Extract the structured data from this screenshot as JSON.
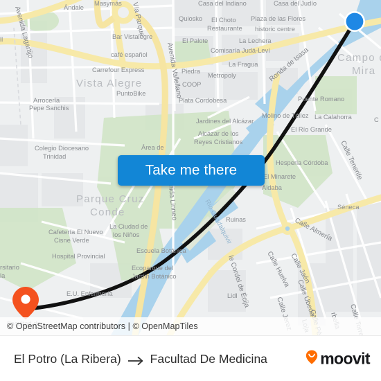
{
  "app": {
    "brand_name": "moovit",
    "brand_icon": "moovit-pin-smile-icon"
  },
  "map": {
    "attribution": "© OpenStreetMap contributors | © OpenMapTiles",
    "origin_marker": {
      "icon": "blue-circle-marker",
      "color": "#1e88e5",
      "label": "El Potro (La Ribera)"
    },
    "destination_marker": {
      "icon": "orange-pin-marker",
      "color": "#f4511e",
      "label": "Facultad De Medicina"
    },
    "route": {
      "color": "#111111",
      "style": "solid-thick-line"
    },
    "labels": [
      "Ándale",
      "Masymás",
      "Casa del Indiano",
      "Casa del Judío",
      "Avenida Lagartijo",
      "Vía Parque",
      "Quiosko",
      "El Choto Restaurante",
      "Plaza de las Flores",
      "historic centre",
      "El Palote",
      "La Lechera",
      "Bar Vistalegre",
      "café español",
      "Comisaría Judá-Levi",
      "La Fragua",
      "Carrefour Express",
      "Piedra",
      "Metropoly",
      "Vista Alegre",
      "Avenida Vallellano",
      "COOP",
      "PuntoBike",
      "Plata Cordobesa",
      "Ronda de Isasa",
      "Puente Romano",
      "Campo de la Mira",
      "Arrocería Pepe Sanchis",
      "Jardines del Alcázar",
      "Molino de Téllez",
      "La Calahorra",
      "El Río Grande",
      "Alcázar de los Reyes Cristianos",
      "Colegio Diocesano Trinidad",
      "Área de",
      "Hesperia Córdoba",
      "Calle Tenerife",
      "Parque Cruz Conde",
      "El Minarete",
      "Aldaba",
      "La Ciudad de los Niños",
      "Avenida Linneo",
      "Río Guadalquivir",
      "Ruinas",
      "Séneca",
      "Cafetería El Nuevo Cisne Verde",
      "Calle Almería",
      "Hospital Provincial",
      "Escuela Botánica",
      "Calle Huelva",
      "Calle Jaén",
      "Ecoparque del Jardín Botánico",
      "Calle Úbeda",
      "Calle Jerez",
      "Calle Cordel de Écija",
      "Lidl",
      "Calle Pérez",
      "Calle Loja",
      "Calle Marbella",
      "Calle Torre",
      "E.U. Enfermería",
      "Universitario",
      "Facultad de Medicina"
    ]
  },
  "cta": {
    "label": "Take me there"
  },
  "footer": {
    "origin": "El Potro (La Ribera)",
    "arrow": "arrow-right-icon",
    "destination": "Facultad De Medicina"
  }
}
